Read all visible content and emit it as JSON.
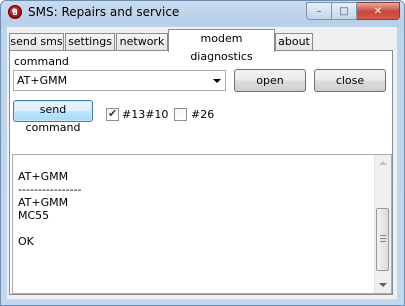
{
  "window": {
    "title": "SMS: Repairs and service",
    "caption": {
      "minimize": "–",
      "maximize": "□",
      "close": "✕"
    }
  },
  "tabs": [
    {
      "label": "send sms"
    },
    {
      "label": "settings"
    },
    {
      "label": "network"
    },
    {
      "label": "modem diagnostics",
      "active": true
    },
    {
      "label": "about"
    }
  ],
  "diagnostics": {
    "command_label": "command",
    "command_value": "AT+GMM",
    "open_label": "open",
    "close_label": "close",
    "send_label": "send command",
    "checkbox1": {
      "label": "#13#10",
      "checked": true
    },
    "checkbox2": {
      "label": "#26",
      "checked": false
    },
    "output_lines": [
      "AT+GMM",
      "----------------",
      "AT+GMM",
      "MC55",
      "",
      "OK"
    ]
  }
}
